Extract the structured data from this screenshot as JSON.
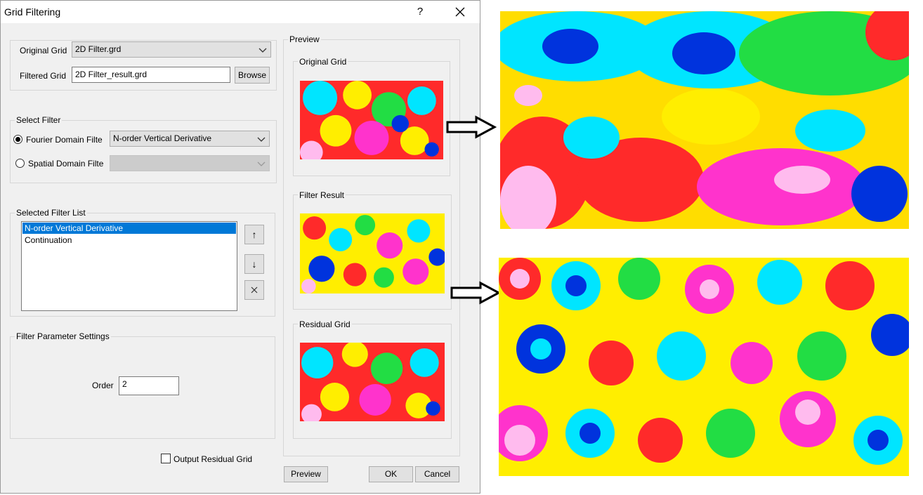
{
  "window": {
    "title": "Grid Filtering",
    "help": "?",
    "close": "✕"
  },
  "grids": {
    "original_label": "Original Grid",
    "original_value": "2D Filter.grd",
    "filtered_label": "Filtered Grid",
    "filtered_value": "2D Filter_result.grd",
    "browse": "Browse"
  },
  "select_filter": {
    "title": "Select Filter",
    "fourier_label": "Fourier Domain Filte",
    "fourier_value": "N-order Vertical Derivative",
    "spatial_label": "Spatial Domain Filte",
    "spatial_value": ""
  },
  "filter_list": {
    "title": "Selected Filter List",
    "items": [
      "N-order Vertical Derivative",
      "Continuation"
    ],
    "up": "↑",
    "down": "↓",
    "remove": "✕"
  },
  "params": {
    "title": "Filter Parameter Settings",
    "order_label": "Order",
    "order_value": "2"
  },
  "preview": {
    "title": "Preview",
    "original": "Original Grid",
    "result": "Filter Result",
    "residual": "Residual Grid"
  },
  "footer": {
    "residual_check": "Output Residual Grid",
    "preview_btn": "Preview",
    "ok": "OK",
    "cancel": "Cancel"
  },
  "icons": {
    "arrows": "right-arrow-icon"
  },
  "colors": {
    "accent": "#0078d7",
    "dialog_bg": "#f0f0f0"
  }
}
